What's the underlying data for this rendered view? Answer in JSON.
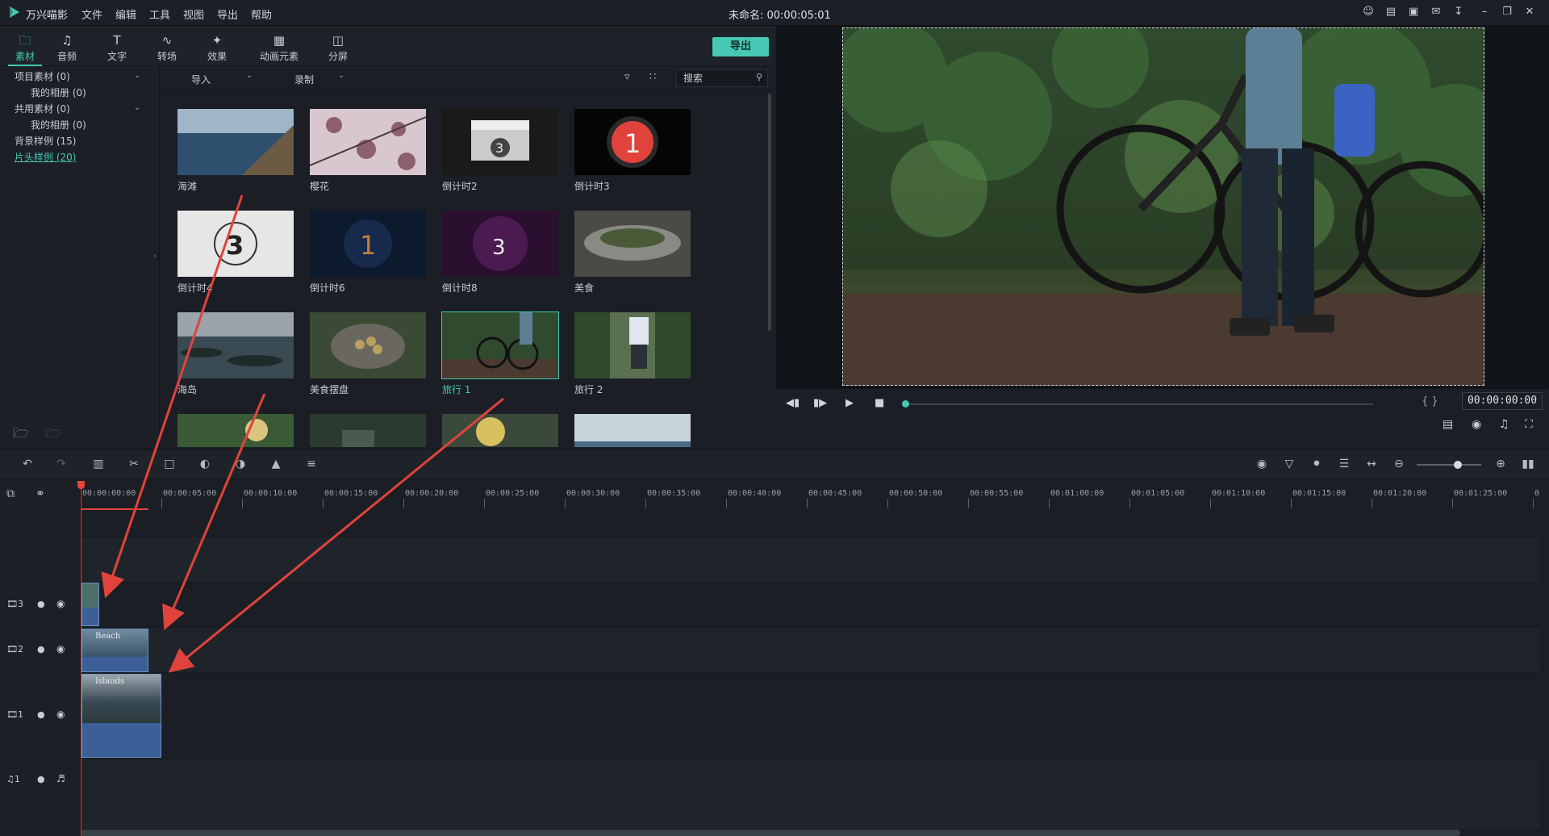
{
  "app": {
    "name": "万兴喵影",
    "document_title": "未命名: 00:00:05:01",
    "menu": [
      "文件",
      "编辑",
      "工具",
      "视图",
      "导出",
      "帮助"
    ],
    "title_icons": [
      "user-icon",
      "cart-icon",
      "save-icon",
      "mail-icon",
      "download-icon",
      "minimize-icon",
      "restore-icon",
      "close-icon"
    ]
  },
  "tabs": [
    {
      "label": "素材",
      "icon": "folder-icon",
      "active": true
    },
    {
      "label": "音频",
      "icon": "music-icon",
      "active": false
    },
    {
      "label": "文字",
      "icon": "text-icon",
      "active": false
    },
    {
      "label": "转场",
      "icon": "transition-icon",
      "active": false
    },
    {
      "label": "效果",
      "icon": "effect-icon",
      "active": false
    },
    {
      "label": "动画元素",
      "icon": "image-icon",
      "active": false
    },
    {
      "label": "分屏",
      "icon": "split-screen-icon",
      "active": false
    }
  ],
  "export_label": "导出",
  "leftnav": {
    "items": [
      {
        "label": "项目素材 (0)",
        "sub": false,
        "chevron": true
      },
      {
        "label": "我的相册 (0)",
        "sub": true,
        "chevron": false
      },
      {
        "label": "共用素材 (0)",
        "sub": false,
        "chevron": true
      },
      {
        "label": "我的相册 (0)",
        "sub": true,
        "chevron": false
      },
      {
        "label": "背景样例 (15)",
        "sub": false,
        "chevron": false
      },
      {
        "label": "片头样例 (20)",
        "sub": false,
        "chevron": false,
        "selected": true
      }
    ]
  },
  "mediabar": {
    "import_label": "导入",
    "record_label": "录制",
    "search_placeholder": "搜索"
  },
  "media": [
    {
      "label": "海滩",
      "kind": "beach"
    },
    {
      "label": "樱花",
      "kind": "sakura"
    },
    {
      "label": "倒计时2",
      "kind": "clap"
    },
    {
      "label": "倒计时3",
      "kind": "count1red"
    },
    {
      "label": "倒计时4",
      "kind": "count3white"
    },
    {
      "label": "倒计时6",
      "kind": "count1blue"
    },
    {
      "label": "倒计时8",
      "kind": "count3purple"
    },
    {
      "label": "美食",
      "kind": "food"
    },
    {
      "label": "海岛",
      "kind": "island"
    },
    {
      "label": "美食摆盘",
      "kind": "bowl"
    },
    {
      "label": "旅行 1",
      "kind": "bike",
      "selected": true
    },
    {
      "label": "旅行 2",
      "kind": "rider"
    },
    {
      "label": "",
      "kind": "forest1"
    },
    {
      "label": "",
      "kind": "forest2"
    },
    {
      "label": "",
      "kind": "forest3"
    },
    {
      "label": "",
      "kind": "lake"
    }
  ],
  "preview": {
    "timecode": "00:00:00:00"
  },
  "ruler_ticks": [
    "00:00:00:00",
    "00:00:05:00",
    "00:00:10:00",
    "00:00:15:00",
    "00:00:20:00",
    "00:00:25:00",
    "00:00:30:00",
    "00:00:35:00",
    "00:00:40:00",
    "00:00:45:00",
    "00:00:50:00",
    "00:00:55:00",
    "00:01:00:00",
    "00:01:05:00",
    "00:01:10:00",
    "00:01:15:00",
    "00:01:20:00",
    "00:01:25:00",
    "0"
  ],
  "tracks": [
    {
      "label": "3",
      "type": "video"
    },
    {
      "label": "2",
      "type": "video"
    },
    {
      "label": "1",
      "type": "video"
    },
    {
      "label": "1",
      "type": "audio"
    }
  ],
  "clips": {
    "beach_label": "Beach",
    "islands_label": "Islands"
  },
  "colors": {
    "accent": "#46c8b4",
    "playhead": "#e0433c",
    "clip": "#3b5f96"
  }
}
